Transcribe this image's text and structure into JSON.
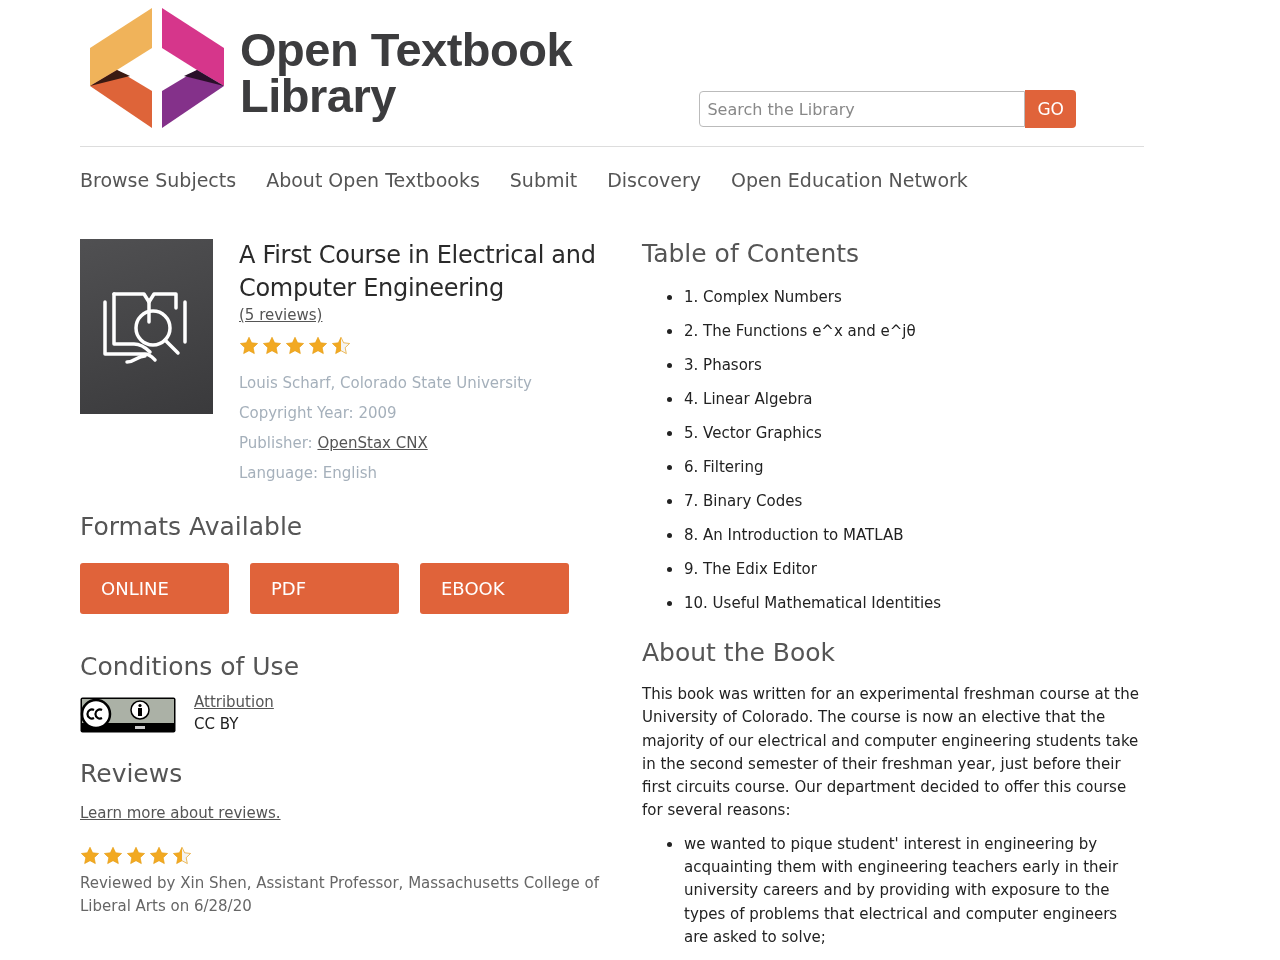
{
  "header": {
    "logo_lines": [
      "Open Textbook",
      "Library"
    ],
    "search": {
      "placeholder": "Search the Library",
      "button": "GO"
    }
  },
  "nav": [
    "Browse Subjects",
    "About Open Textbooks",
    "Submit",
    "Discovery",
    "Open Education Network"
  ],
  "book": {
    "title": "A First Course in Electrical and Computer Engineering",
    "reviews_link": "(5 reviews)",
    "stars": 4.5,
    "author": "Louis Scharf, Colorado State University",
    "copyright": "Copyright Year: 2009",
    "publisher_label": "Publisher:",
    "publisher": "OpenStax CNX",
    "language": "Language: English"
  },
  "formats": {
    "heading": "Formats Available",
    "buttons": [
      "ONLINE",
      "PDF",
      "EBOOK"
    ]
  },
  "conditions": {
    "heading": "Conditions of Use",
    "license_link": "Attribution",
    "license": "CC BY"
  },
  "reviews": {
    "heading": "Reviews",
    "learn_more": "Learn more about reviews.",
    "items": [
      {
        "stars": 4.5,
        "byline": "Reviewed by Xin Shen, Assistant Professor, Massachusetts College of Liberal Arts on 6/28/20"
      }
    ]
  },
  "toc": {
    "heading": "Table of Contents",
    "items": [
      "1. Complex Numbers",
      "2. The Functions e^x and e^jθ",
      "3. Phasors",
      "4. Linear Algebra",
      "5. Vector Graphics",
      "6. Filtering",
      "7. Binary Codes",
      "8. An Introduction to MATLAB",
      "9. The Edix Editor",
      "10. Useful Mathematical Identities"
    ]
  },
  "about": {
    "heading": "About the Book",
    "paragraph": "This book was written for an experimental freshman course at the University of Colorado. The course is now an elective that the majority of our electrical and computer engineering students take in the second semester of their freshman year, just before their first circuits course. Our department decided to offer this course for several reasons:",
    "bullets": [
      "we wanted to pique student' interest in engineering by acquainting them with engineering teachers early in their university careers and by providing with exposure to the types of problems that electrical and computer engineers are asked to solve;"
    ]
  }
}
